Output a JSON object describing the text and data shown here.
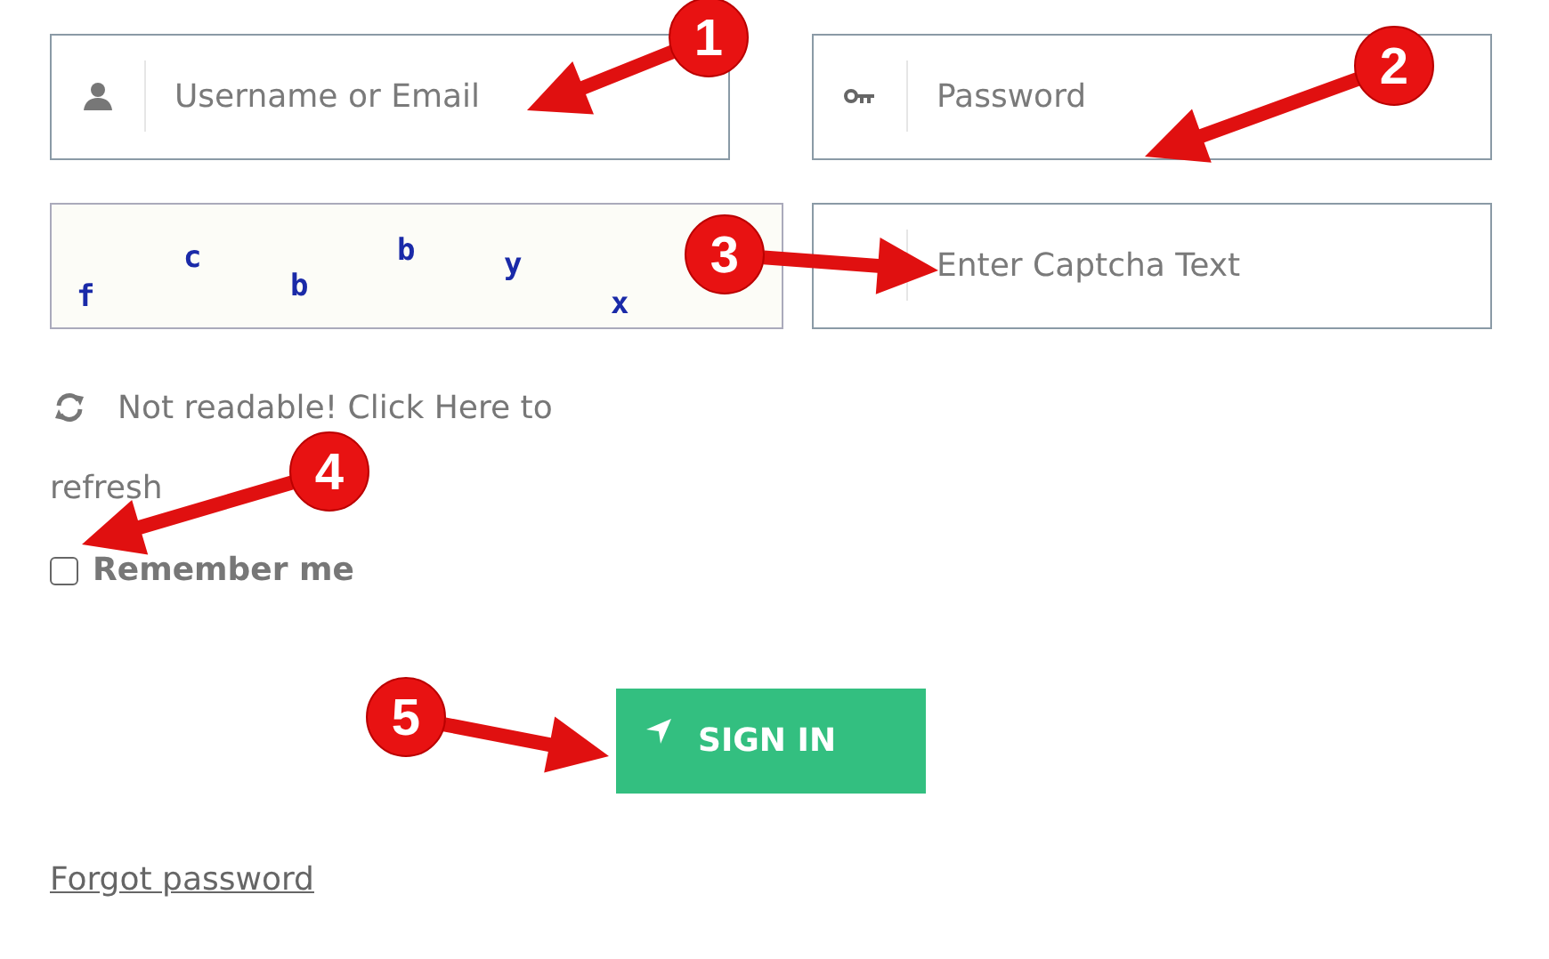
{
  "fields": [
    {
      "kind": "user",
      "placeholder": "Username or Email"
    },
    {
      "kind": "password",
      "placeholder": "Password"
    }
  ],
  "captcha": {
    "characters": [
      "f",
      "c",
      "b",
      "b",
      "y",
      "x"
    ]
  },
  "captcha_field": {
    "placeholder": "Enter Captcha Text"
  },
  "refresh_link": [
    "Not readable! Click Here to",
    "refresh"
  ],
  "remember": {
    "label": "Remember me",
    "checked": false
  },
  "sign_in_button": "SIGN IN",
  "forgot_link": "Forgot password",
  "annotations": [
    {
      "label": "1"
    },
    {
      "label": "2"
    },
    {
      "label": "3"
    },
    {
      "label": "4"
    },
    {
      "label": "5"
    }
  ]
}
